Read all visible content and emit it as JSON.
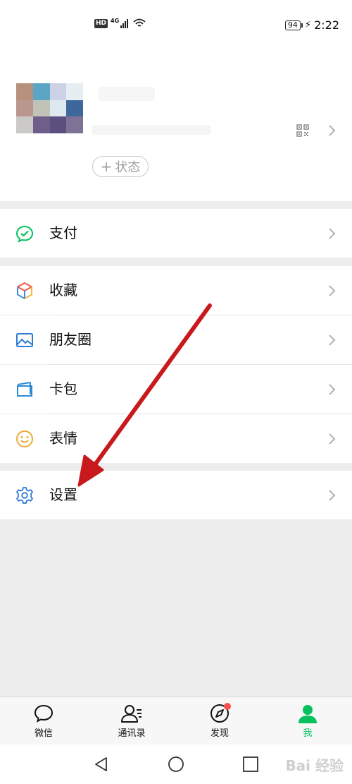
{
  "status_bar": {
    "hd": "HD",
    "network": "4G",
    "battery": "94",
    "time": "2:22"
  },
  "profile": {
    "status_button_plus": "+",
    "status_button_label": "状态",
    "avatar_colors": [
      "#b8917d",
      "#5ba5c5",
      "#cdd1e5",
      "#e6eef2",
      "#b9968e",
      "#c1c3b8",
      "#dde9ee",
      "#3e689b",
      "#cbcac6",
      "#6f5e89",
      "#5a4f7e",
      "#7e7296"
    ]
  },
  "menu": {
    "pay": {
      "label": "支付",
      "icon": "pay-check-bubble-icon",
      "color": "#07c160"
    },
    "favorites": {
      "label": "收藏",
      "icon": "cube-icon"
    },
    "moments": {
      "label": "朋友圈",
      "icon": "photo-icon",
      "color": "#2d7bd6"
    },
    "cards": {
      "label": "卡包",
      "icon": "card-wallet-icon",
      "color": "#2d8bd6"
    },
    "stickers": {
      "label": "表情",
      "icon": "smiley-icon",
      "color": "#f0a83a"
    },
    "settings": {
      "label": "设置",
      "icon": "gear-icon",
      "color": "#2d7bd6"
    }
  },
  "tabs": [
    {
      "label": "微信",
      "icon": "chat-bubble-icon",
      "active": false
    },
    {
      "label": "通讯录",
      "icon": "contacts-icon",
      "active": false
    },
    {
      "label": "发现",
      "icon": "compass-icon",
      "active": false,
      "badge": true
    },
    {
      "label": "我",
      "icon": "person-icon",
      "active": true
    }
  ],
  "colors": {
    "accent": "#07c160",
    "annotation_arrow": "#c8191c",
    "badge": "#f55151"
  },
  "watermark": "Bai 经验"
}
